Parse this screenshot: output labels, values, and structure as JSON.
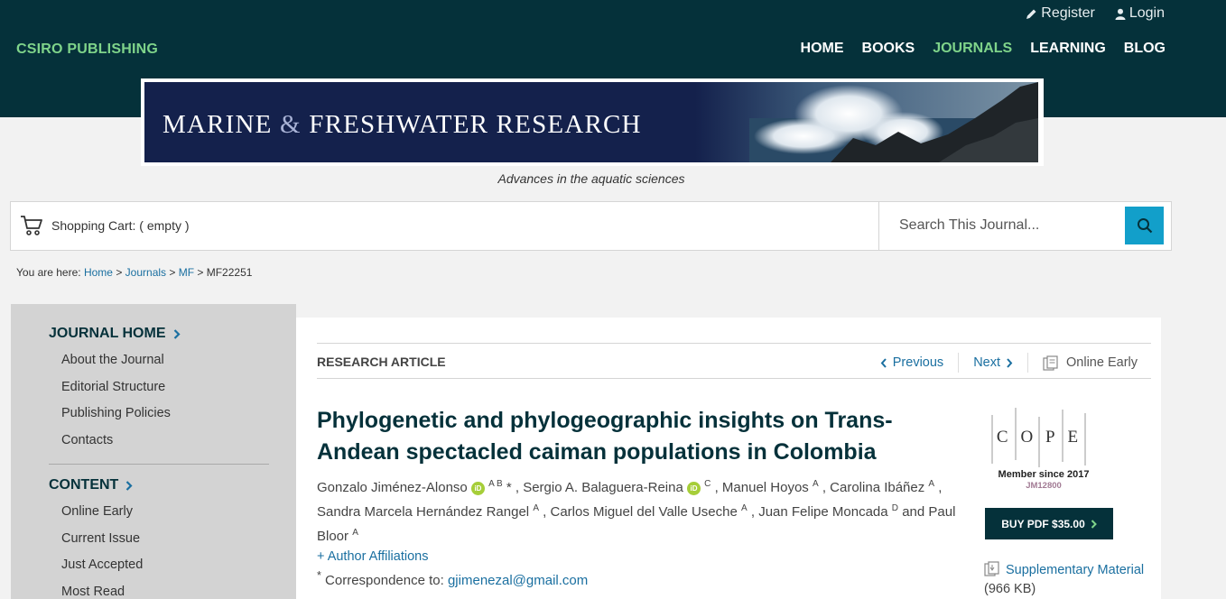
{
  "header": {
    "brand": "CSIRO PUBLISHING",
    "register": "Register",
    "login": "Login",
    "nav": [
      "HOME",
      "BOOKS",
      "JOURNALS",
      "LEARNING",
      "BLOG"
    ],
    "active_nav": "JOURNALS",
    "accent_color": "#7fd48a",
    "bar_color": "#05313a"
  },
  "banner": {
    "title_part1": "MARINE",
    "title_amp": "&",
    "title_part2": "FRESHWATER RESEARCH",
    "tagline": "Advances in the aquatic sciences"
  },
  "cart": {
    "label": "Shopping Cart: ( empty )"
  },
  "search": {
    "placeholder": "Search This Journal..."
  },
  "breadcrumb": {
    "prefix": "You are here:",
    "items": [
      "Home",
      "Journals",
      "MF"
    ],
    "current": "MF22251"
  },
  "sidebar": {
    "journal_home": "JOURNAL HOME",
    "journal_links": [
      "About the Journal",
      "Editorial Structure",
      "Publishing Policies",
      "Contacts"
    ],
    "content": "CONTENT",
    "content_links": [
      "Online Early",
      "Current Issue",
      "Just Accepted",
      "Most Read"
    ]
  },
  "article": {
    "type": "RESEARCH ARTICLE",
    "prev": "Previous",
    "next": "Next",
    "online_early": "Online Early",
    "title": "Phylogenetic and phylogeographic insights on Trans-Andean spectacled caiman populations in Colombia",
    "author_affiliations": "+ Author Affiliations",
    "correspondence_label": "Correspondence to:",
    "email": "gjimenezal@gmail.com"
  },
  "sidepanel": {
    "cope_letters": [
      "C",
      "O",
      "P",
      "E"
    ],
    "cope_member": "Member since 2017",
    "cope_id": "JM12800",
    "buy": "BUY PDF $35.00",
    "supplementary": "Supplementary Material",
    "supplementary_size": "(966 KB)"
  }
}
